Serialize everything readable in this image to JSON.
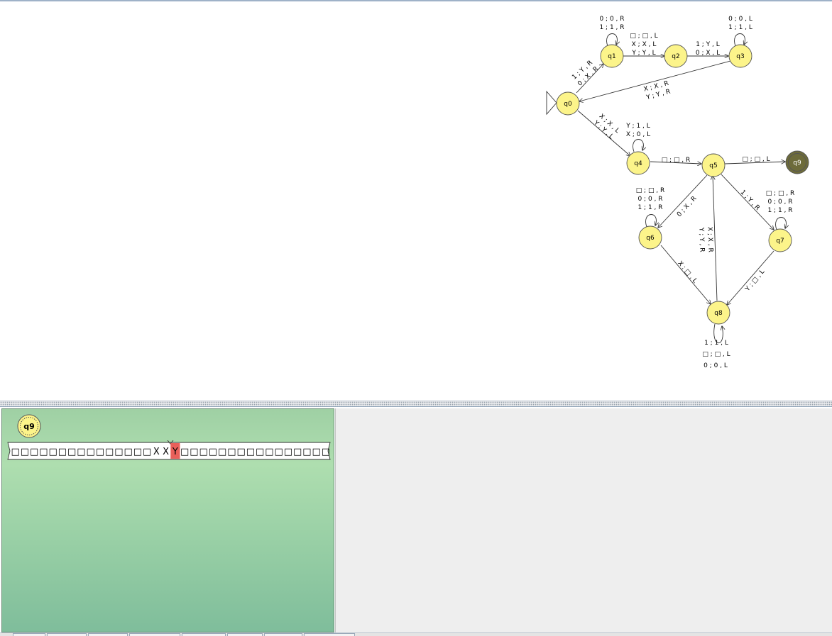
{
  "colors": {
    "state_fill": "#fcf48a",
    "state_stroke": "#555555",
    "final_state_fill": "#6d6b3a",
    "edge": "#333333",
    "tape_head_cell": "#e8605a",
    "sim_panel": "#a8dbab",
    "right_panel": "#eeeeee"
  },
  "diagram": {
    "initial_state": "q0",
    "final_states": [
      "q9"
    ],
    "states": [
      "q0",
      "q1",
      "q2",
      "q3",
      "q4",
      "q5",
      "q6",
      "q7",
      "q8",
      "q9"
    ],
    "transitions": [
      {
        "from": "q1",
        "to": "q1",
        "labels": [
          "0 ; 0 , R",
          "1 ; 1 , R"
        ]
      },
      {
        "from": "q1",
        "to": "q2",
        "labels": [
          "□ ; □ , L",
          "X ; X , L",
          "Y ; Y , L"
        ]
      },
      {
        "from": "q2",
        "to": "q3",
        "labels": [
          "1 ; Y , L",
          "0 ; X , L"
        ]
      },
      {
        "from": "q3",
        "to": "q3",
        "labels": [
          "0 ; 0 , L",
          "1 ; 1 , L"
        ]
      },
      {
        "from": "q0",
        "to": "q1",
        "labels": [
          "1 ; Y , R",
          "0 ; X , R"
        ]
      },
      {
        "from": "q3",
        "to": "q0",
        "labels": [
          "X ; X , R",
          "Y ; Y , R"
        ]
      },
      {
        "from": "q0",
        "to": "q4",
        "labels": [
          "X ; X , L",
          "Y ; Y , L"
        ]
      },
      {
        "from": "q4",
        "to": "q4",
        "labels": [
          "Y ; 1 , L",
          "X ; 0 , L"
        ]
      },
      {
        "from": "q4",
        "to": "q5",
        "labels": [
          "□ ; □ , R"
        ]
      },
      {
        "from": "q5",
        "to": "q9",
        "labels": [
          "□ ; □ , L"
        ]
      },
      {
        "from": "q6",
        "to": "q6",
        "labels": [
          "□ ; □ , R",
          "0 ; 0 , R",
          "1 ; 1 , R"
        ]
      },
      {
        "from": "q5",
        "to": "q6",
        "labels": [
          "0 ; X , R"
        ]
      },
      {
        "from": "q5",
        "to": "q7",
        "labels": [
          "1 ; Y , R"
        ]
      },
      {
        "from": "q7",
        "to": "q7",
        "labels": [
          "□ ; □ , R",
          "0 ; 0 , R",
          "1 ; 1 , R"
        ]
      },
      {
        "from": "q8",
        "to": "q5",
        "labels": [
          "X ; X , R",
          "Y ; Y , R"
        ]
      },
      {
        "from": "q6",
        "to": "q8",
        "labels": [
          "X ; □ , L"
        ]
      },
      {
        "from": "q7",
        "to": "q8",
        "labels": [
          "Y ; □ , L"
        ]
      },
      {
        "from": "q8",
        "to": "q8",
        "labels": [
          "1 ; 1 , L",
          "□ ; □ , L",
          "0 ; 0 , L"
        ]
      }
    ]
  },
  "simulation": {
    "current_state": "q9",
    "tape": [
      "□",
      "□",
      "□",
      "□",
      "□",
      "□",
      "□",
      "□",
      "□",
      "□",
      "□",
      "□",
      "□",
      "□",
      "□",
      "X",
      "X",
      "Y",
      "□",
      "□",
      "□",
      "□",
      "□",
      "□",
      "□",
      "□",
      "□",
      "□",
      "□",
      "□",
      "□",
      "□",
      "□",
      "□"
    ],
    "head_index": 17
  }
}
